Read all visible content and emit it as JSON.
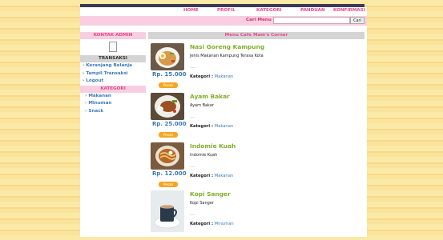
{
  "nav": {
    "items": [
      "HOME",
      "PROFIL",
      "KATEGORI",
      "PANDUAN",
      "KONFIRMASI"
    ]
  },
  "search": {
    "label": "Cari Menu",
    "placeholder": "",
    "value": "",
    "button": "Cari"
  },
  "sidebar": {
    "admin_heading": "KONTAK ADMIN",
    "transaksi_heading": "TRANSAKSI",
    "transaksi_items": [
      "Keranjang Belanja",
      "Tampil Transaksi",
      "Logout"
    ],
    "kategori_heading": "KATEGORI",
    "kategori_items": [
      "Makanan",
      "Minuman",
      "Snack"
    ]
  },
  "content": {
    "heading": "Menu Cafe Mam's Corner",
    "order_button": "Pesan",
    "kategori_label": "Kategori :",
    "products": [
      {
        "name": "Nasi Goreng Kampung",
        "description": "Jenis Makanan Kampung Terasa Kota",
        "price": "Rp. 15.000",
        "dots": "....",
        "kategori": "Makanan"
      },
      {
        "name": "Ayam Bakar",
        "description": "Ayam Bakar",
        "price": "Rp. 25.000",
        "dots": "....",
        "kategori": "Makanan"
      },
      {
        "name": "Indomie Kuah",
        "description": "Indomie Kuah",
        "price": "Rp. 12.000",
        "dots": "....",
        "kategori": "Makanan"
      },
      {
        "name": "Kopi Sanger",
        "description": "Kopi Sanger",
        "price": "",
        "dots": "....",
        "kategori": "Minuman"
      }
    ]
  },
  "colors": {
    "nav_link": "#e8478f",
    "product_name": "#7fae2a",
    "price": "#3a7bb8",
    "order_button": "#f5a623",
    "header_pink": "#f7cfe0"
  }
}
